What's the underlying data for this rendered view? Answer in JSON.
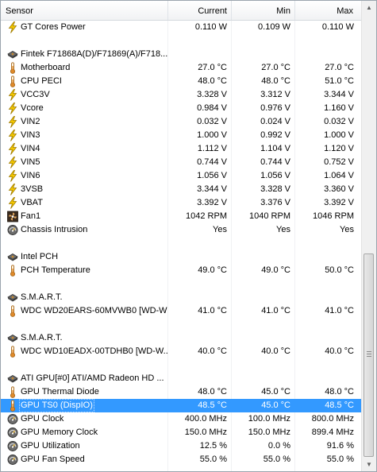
{
  "columns": {
    "sensor": "Sensor",
    "current": "Current",
    "min": "Min",
    "max": "Max"
  },
  "rows": [
    {
      "kind": "sensor",
      "icon": "bolt",
      "label": "GT Cores Power",
      "current": "0.110 W",
      "min": "0.109 W",
      "max": "0.110 W"
    },
    {
      "kind": "blank"
    },
    {
      "kind": "header",
      "icon": "chip",
      "label": "Fintek F71868A(D)/F71869(A)/F718..."
    },
    {
      "kind": "sensor",
      "icon": "thermo",
      "label": "Motherboard",
      "current": "27.0 °C",
      "min": "27.0 °C",
      "max": "27.0 °C"
    },
    {
      "kind": "sensor",
      "icon": "thermo",
      "label": "CPU PECI",
      "current": "48.0 °C",
      "min": "48.0 °C",
      "max": "51.0 °C"
    },
    {
      "kind": "sensor",
      "icon": "bolt",
      "label": "VCC3V",
      "current": "3.328 V",
      "min": "3.312 V",
      "max": "3.344 V"
    },
    {
      "kind": "sensor",
      "icon": "bolt",
      "label": "Vcore",
      "current": "0.984 V",
      "min": "0.976 V",
      "max": "1.160 V"
    },
    {
      "kind": "sensor",
      "icon": "bolt",
      "label": "VIN2",
      "current": "0.032 V",
      "min": "0.024 V",
      "max": "0.032 V"
    },
    {
      "kind": "sensor",
      "icon": "bolt",
      "label": "VIN3",
      "current": "1.000 V",
      "min": "0.992 V",
      "max": "1.000 V"
    },
    {
      "kind": "sensor",
      "icon": "bolt",
      "label": "VIN4",
      "current": "1.112 V",
      "min": "1.104 V",
      "max": "1.120 V"
    },
    {
      "kind": "sensor",
      "icon": "bolt",
      "label": "VIN5",
      "current": "0.744 V",
      "min": "0.744 V",
      "max": "0.752 V"
    },
    {
      "kind": "sensor",
      "icon": "bolt",
      "label": "VIN6",
      "current": "1.056 V",
      "min": "1.056 V",
      "max": "1.064 V"
    },
    {
      "kind": "sensor",
      "icon": "bolt",
      "label": "3VSB",
      "current": "3.344 V",
      "min": "3.328 V",
      "max": "3.360 V"
    },
    {
      "kind": "sensor",
      "icon": "bolt",
      "label": "VBAT",
      "current": "3.392 V",
      "min": "3.376 V",
      "max": "3.392 V"
    },
    {
      "kind": "sensor",
      "icon": "fan",
      "label": "Fan1",
      "current": "1042 RPM",
      "min": "1040 RPM",
      "max": "1046 RPM"
    },
    {
      "kind": "sensor",
      "icon": "gauge",
      "label": "Chassis Intrusion",
      "current": "Yes",
      "min": "Yes",
      "max": "Yes"
    },
    {
      "kind": "blank"
    },
    {
      "kind": "header",
      "icon": "chip",
      "label": "Intel PCH"
    },
    {
      "kind": "sensor",
      "icon": "thermo",
      "label": "PCH Temperature",
      "current": "49.0 °C",
      "min": "49.0 °C",
      "max": "50.0 °C"
    },
    {
      "kind": "blank"
    },
    {
      "kind": "header",
      "icon": "chip",
      "label": "S.M.A.R.T."
    },
    {
      "kind": "sensor",
      "icon": "thermo",
      "label": "WDC WD20EARS-60MVWB0 [WD-W...",
      "current": "41.0 °C",
      "min": "41.0 °C",
      "max": "41.0 °C"
    },
    {
      "kind": "blank"
    },
    {
      "kind": "header",
      "icon": "chip",
      "label": "S.M.A.R.T."
    },
    {
      "kind": "sensor",
      "icon": "thermo",
      "label": "WDC WD10EADX-00TDHB0 [WD-W...",
      "current": "40.0 °C",
      "min": "40.0 °C",
      "max": "40.0 °C"
    },
    {
      "kind": "blank"
    },
    {
      "kind": "header",
      "icon": "chip",
      "label": "ATI GPU[#0] ATI/AMD Radeon HD ..."
    },
    {
      "kind": "sensor",
      "icon": "thermo",
      "label": "GPU Thermal Diode",
      "current": "48.0 °C",
      "min": "45.0 °C",
      "max": "48.0 °C"
    },
    {
      "kind": "sensor",
      "icon": "thermo",
      "label": "GPU TS0 (DispIO)",
      "current": "48.5 °C",
      "min": "45.0 °C",
      "max": "48.5 °C",
      "selected": true
    },
    {
      "kind": "sensor",
      "icon": "gauge",
      "label": "GPU Clock",
      "current": "400.0 MHz",
      "min": "100.0 MHz",
      "max": "800.0 MHz"
    },
    {
      "kind": "sensor",
      "icon": "gauge",
      "label": "GPU Memory Clock",
      "current": "150.0 MHz",
      "min": "150.0 MHz",
      "max": "899.4 MHz"
    },
    {
      "kind": "sensor",
      "icon": "gauge",
      "label": "GPU Utilization",
      "current": "12.5 %",
      "min": "0.0 %",
      "max": "91.6 %"
    },
    {
      "kind": "sensor",
      "icon": "gauge",
      "label": "GPU Fan Speed",
      "current": "55.0 %",
      "min": "55.0 %",
      "max": "55.0 %"
    }
  ],
  "icons": {
    "bolt": "lightning-bolt-icon",
    "thermo": "thermometer-icon",
    "chip": "chip-icon",
    "fan": "fan-icon",
    "gauge": "gauge-icon"
  },
  "colors": {
    "selection": "#3399ff",
    "bolt": "#f2c600",
    "thermometer": "#cf8a2e"
  }
}
